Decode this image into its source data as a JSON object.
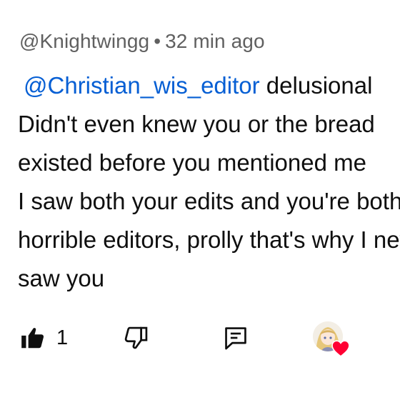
{
  "comment": {
    "author": "@Knightwingg",
    "separator": "•",
    "time": "32 min ago",
    "mention": "@Christian_wis_editor",
    "lines": [
      " delusional",
      "Didn't even knew you or the bread",
      "existed before you mentioned me",
      "I saw both your edits and you're both",
      "horrible editors, prolly that's why I never",
      "saw you"
    ]
  },
  "actions": {
    "like_icon": "thumbs-up-filled-icon",
    "like_count": "1",
    "dislike_icon": "thumbs-down-icon",
    "reply_icon": "reply-comment-icon",
    "creator_heart": "creator-heart-icon",
    "heart_color": "#ff0033"
  }
}
